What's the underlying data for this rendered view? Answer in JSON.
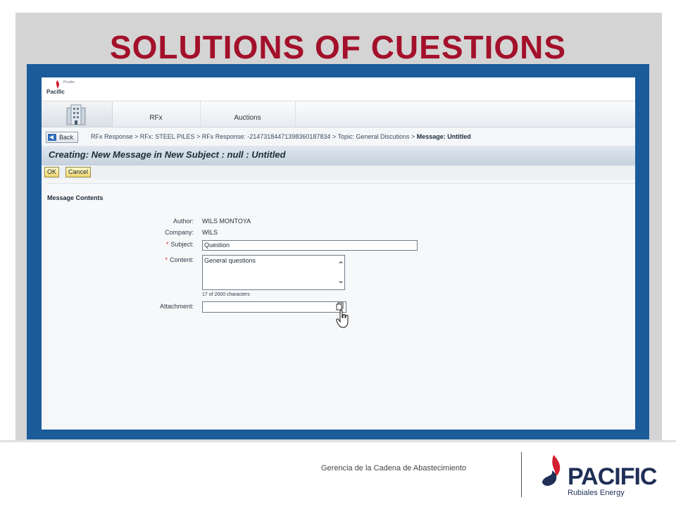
{
  "slide": {
    "title": "SOLUTIONS OF CUESTIONS",
    "footer_text": "Gerencia de la Cadena de Abastecimiento",
    "logo": {
      "word": "PACIFIC",
      "tagline": "Rubiales Energy"
    }
  },
  "app": {
    "logo_text": "Pacific",
    "logo_small": "Pruebs",
    "tabs": [
      "RFx",
      "Auctions"
    ],
    "back_label": "Back",
    "breadcrumb": "RFx Response > RFx: STEEL PILES > RFx Response: -21473184471398360187834 > Topic: General Discutions > ",
    "breadcrumb_current": "Message: Untitled",
    "page_title": "Creating: New Message in New Subject : null : Untitled",
    "ok_label": "OK",
    "cancel_label": "Cancel",
    "section_title": "Message Contents",
    "form": {
      "author_label": "Author:",
      "author_value": "WILS MONTOYA",
      "company_label": "Company:",
      "company_value": "WILS",
      "subject_label": "Subject:",
      "subject_value": "Question",
      "content_label": "Content:",
      "content_value": "General questions",
      "char_count": "17 of 2000 characters",
      "attachment_label": "Attachment:",
      "required_mark": "*"
    }
  },
  "colors": {
    "title": "#a3102a",
    "frame": "#1c5b9a",
    "brand": "#1f2f56",
    "brand_flame": "#d21f2f"
  }
}
